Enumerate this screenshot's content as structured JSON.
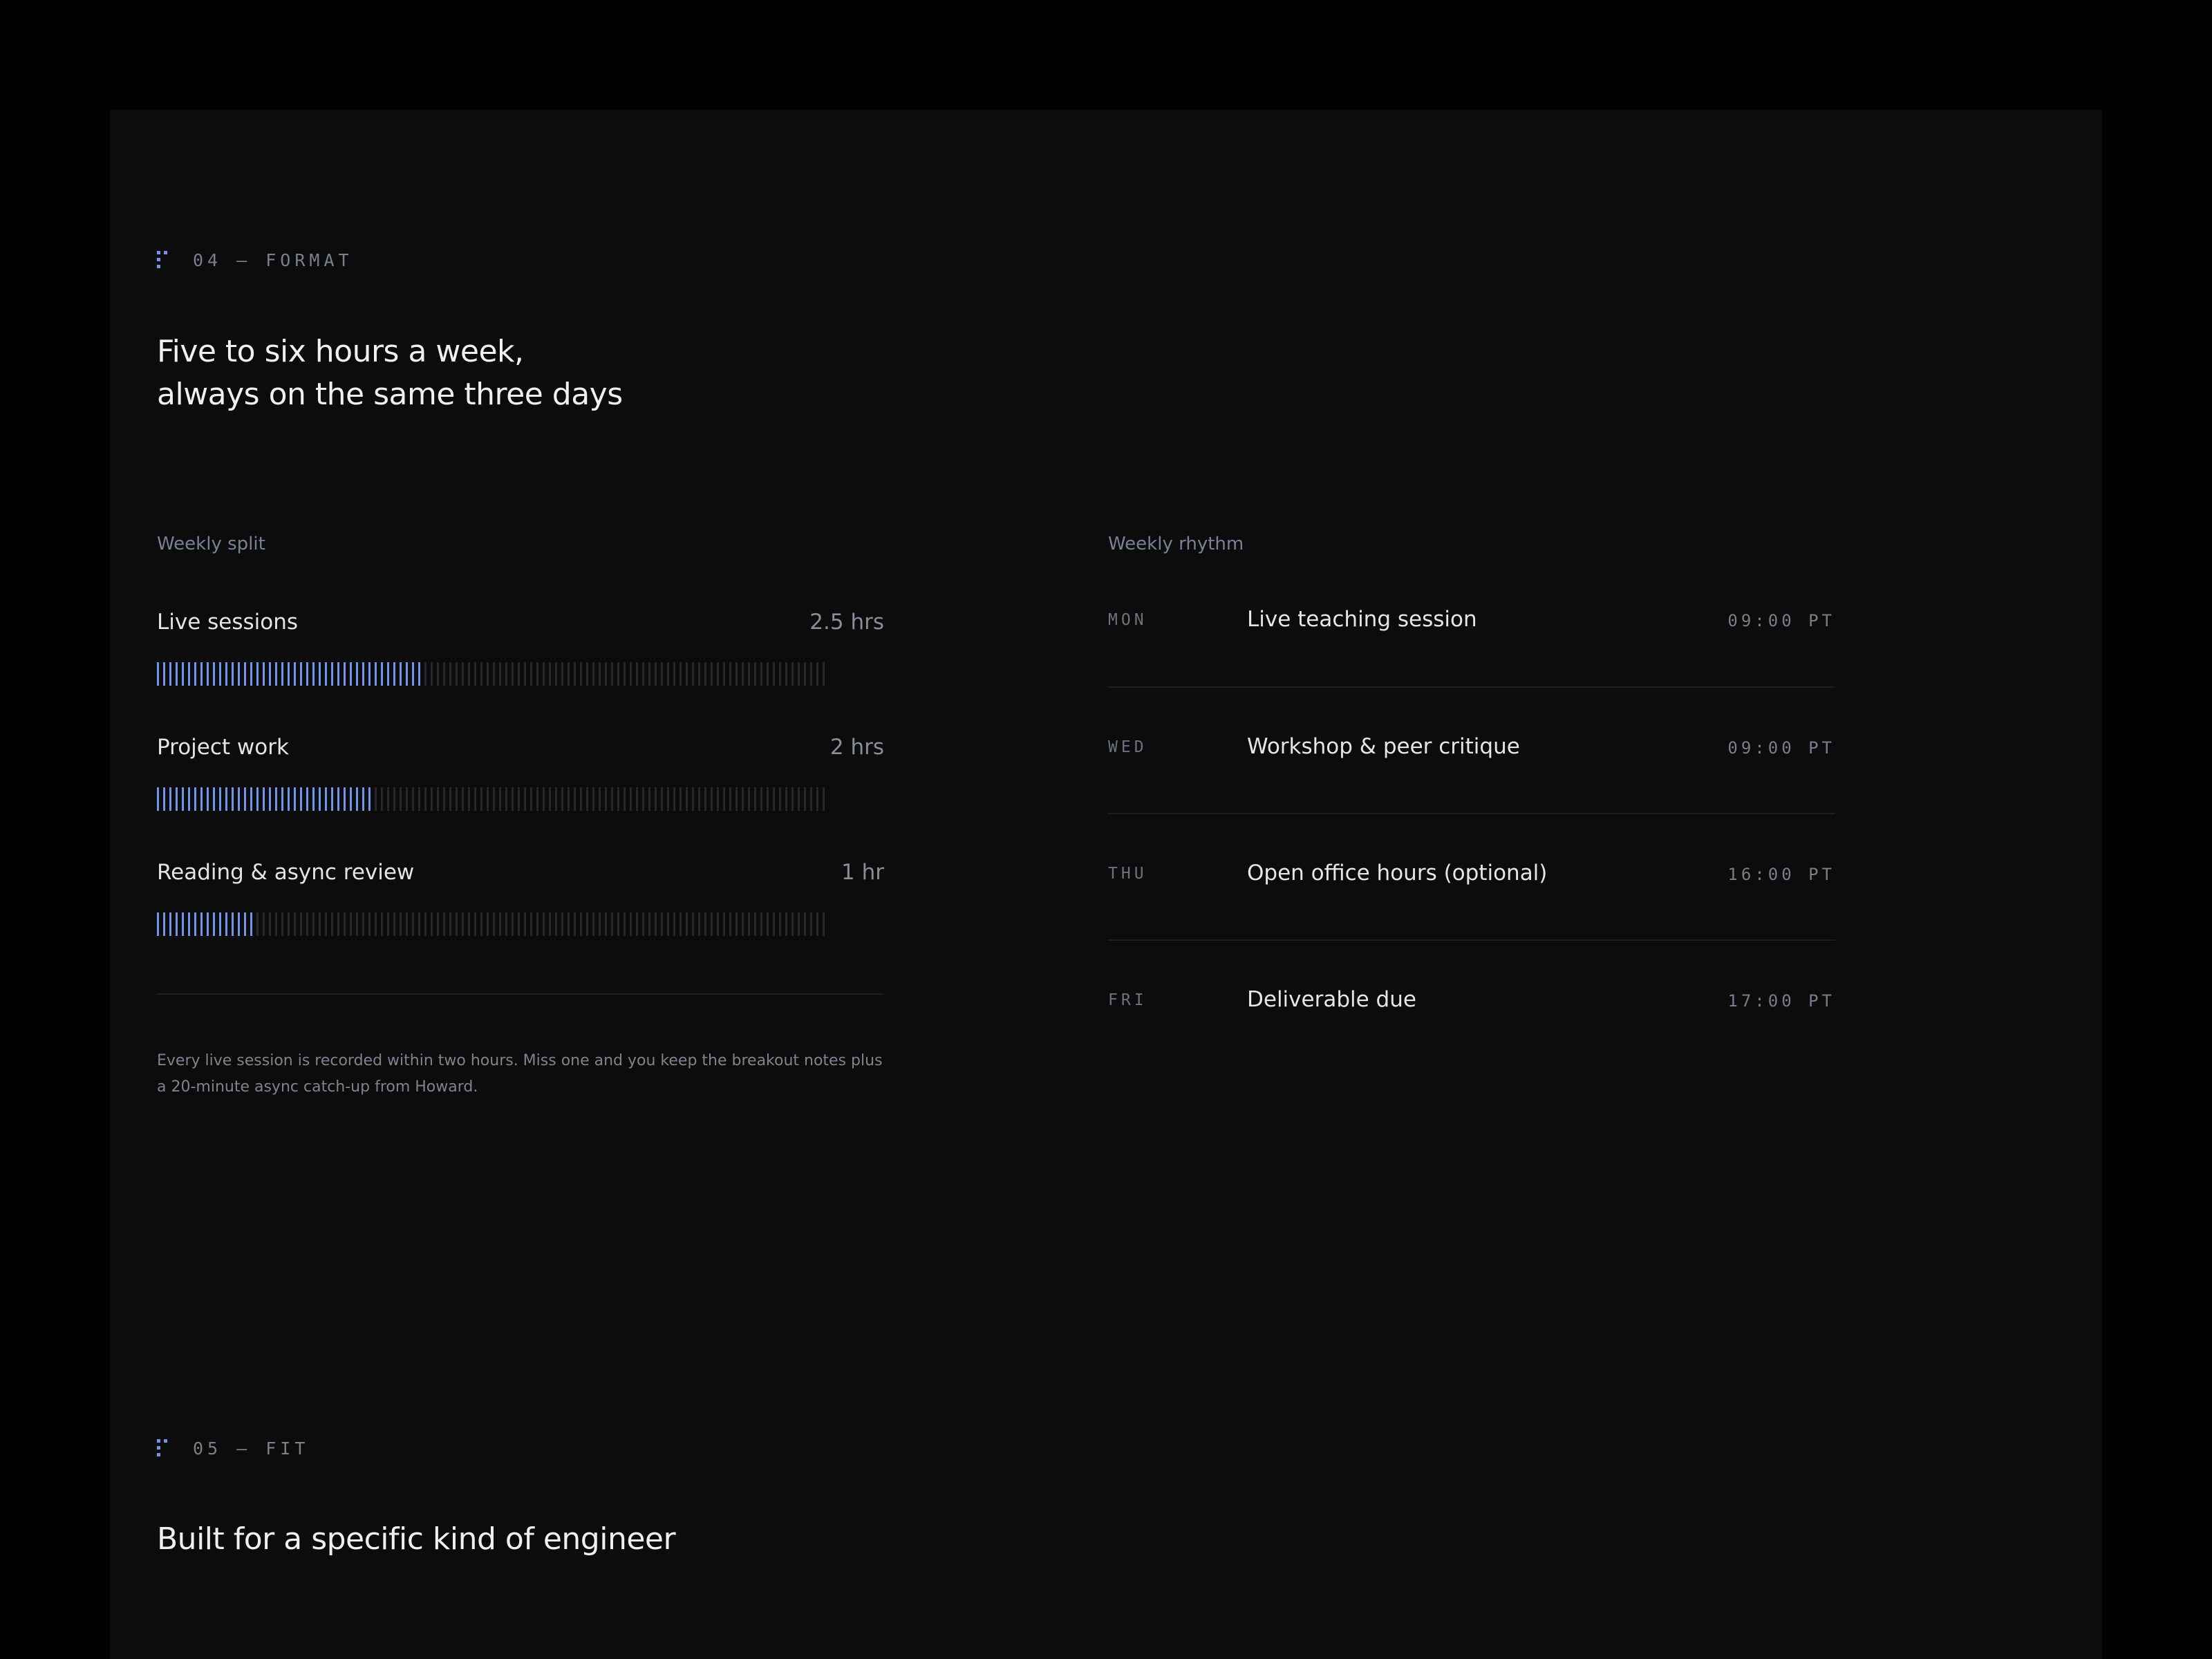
{
  "sections": {
    "format": {
      "eyebrow": "04 — FORMAT",
      "headline_line1": "Five to six hours a week,",
      "headline_line2": "always on the same three days"
    },
    "fit": {
      "eyebrow": "05 — FIT",
      "headline": "Built for a specific kind of engineer"
    }
  },
  "weekly_split": {
    "title": "Weekly split",
    "items": [
      {
        "label": "Live sessions",
        "amount": "2.5 hrs",
        "fill_fraction": 0.4
      },
      {
        "label": "Project work",
        "amount": "2 hrs",
        "fill_fraction": 0.32
      },
      {
        "label": "Reading & async review",
        "amount": "1 hr",
        "fill_fraction": 0.15
      }
    ],
    "note": "Every live session is recorded within two hours. Miss one and you keep the breakout notes plus a 20-minute async catch-up from Howard."
  },
  "weekly_rhythm": {
    "title": "Weekly rhythm",
    "items": [
      {
        "day": "MON",
        "event": "Live teaching session",
        "time": "09:00 PT"
      },
      {
        "day": "WED",
        "event": "Workshop & peer critique",
        "time": "09:00 PT"
      },
      {
        "day": "THU",
        "event": "Open office hours (optional)",
        "time": "16:00 PT"
      },
      {
        "day": "FRI",
        "event": "Deliverable due",
        "time": "17:00 PT"
      }
    ]
  },
  "colors": {
    "accent": "#6f95e8",
    "bar_empty": "#26272b",
    "background": "#0c0c0d"
  }
}
